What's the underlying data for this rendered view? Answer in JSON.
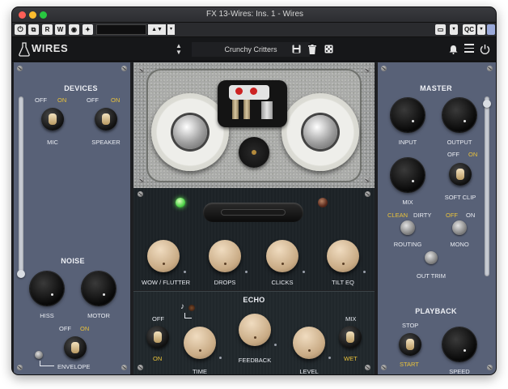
{
  "window": {
    "title": "FX 13-Wires: Ins. 1 - Wires"
  },
  "host_toolbar": {
    "buttons": [
      "R",
      "W"
    ],
    "auto_label": "QC"
  },
  "plugin_bar": {
    "logo": "WIRES",
    "preset_name": "Crunchy Critters"
  },
  "devices": {
    "title": "DEVICES",
    "mic": {
      "label": "MIC",
      "off": "OFF",
      "on": "ON"
    },
    "speaker": {
      "label": "SPEAKER",
      "off": "OFF",
      "on": "ON"
    }
  },
  "noise": {
    "title": "NOISE",
    "hiss": "HISS",
    "motor": "MOTOR",
    "envelope": {
      "label": "ENVELOPE",
      "off": "OFF",
      "on": "ON"
    }
  },
  "fx": {
    "wow_flutter": "WOW / FLUTTER",
    "drops": "DROPS",
    "clicks": "CLICKS",
    "tilt_eq": "TILT EQ"
  },
  "echo": {
    "title": "ECHO",
    "off": "OFF",
    "on": "ON",
    "time": "TIME",
    "feedback": "FEEDBACK",
    "level": "LEVEL",
    "mix": "MIX",
    "wet": "WET"
  },
  "master": {
    "title": "MASTER",
    "input": "INPUT",
    "output": "OUTPUT",
    "mix": "MIX",
    "soft_clip": {
      "label": "SOFT CLIP",
      "off": "OFF",
      "on": "ON"
    },
    "routing": {
      "label": "ROUTING",
      "clean": "CLEAN",
      "dirty": "DIRTY"
    },
    "mono": {
      "label": "MONO",
      "off": "OFF",
      "on": "ON"
    },
    "out_trim": "OUT TRIM"
  },
  "playback": {
    "title": "PLAYBACK",
    "stop": "STOP",
    "start": "START",
    "speed": "SPEED"
  },
  "colors": {
    "panel": "#586177",
    "accent": "#e9c23b",
    "dark_panel": "#1c2226"
  }
}
